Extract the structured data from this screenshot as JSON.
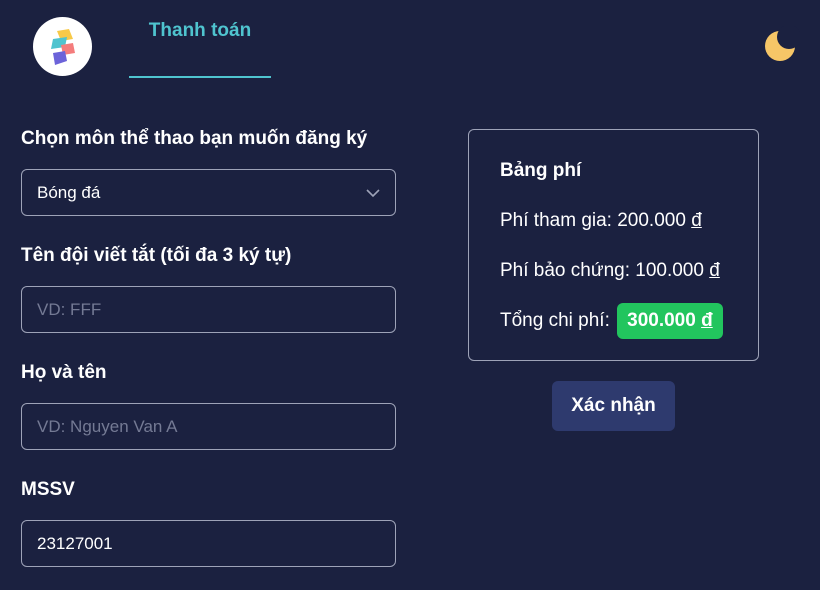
{
  "header": {
    "logo_icon": "app-logo",
    "tab_label": "Thanh toán",
    "theme_icon": "moon-icon",
    "accent_color": "#4fc4cf"
  },
  "form": {
    "sport": {
      "label": "Chọn môn thể thao bạn muốn đăng ký",
      "value": "Bóng đá"
    },
    "team_abbr": {
      "label": "Tên đội viết tắt (tối đa 3 ký tự)",
      "placeholder": "VD: FFF",
      "value": ""
    },
    "full_name": {
      "label": "Họ và tên",
      "placeholder": "VD: Nguyen Van A",
      "value": ""
    },
    "student_id": {
      "label": "MSSV",
      "value": "23127001"
    }
  },
  "fees": {
    "title": "Bảng phí",
    "participation_label": "Phí tham gia: ",
    "participation_amount": "200.000",
    "deposit_label": "Phí bảo chứng: ",
    "deposit_amount": "100.000",
    "total_label": "Tổng chi phí: ",
    "total_amount": "300.000",
    "currency": "đ",
    "total_badge_color": "#22c55e"
  },
  "actions": {
    "confirm_label": "Xác nhận"
  }
}
